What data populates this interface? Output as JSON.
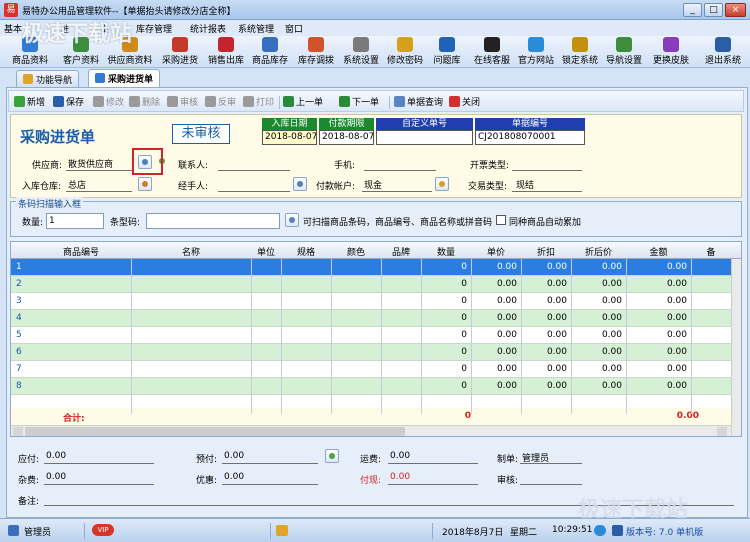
{
  "window": {
    "title": "易特办公用品管理软件--【单据抬头请修改分店全称】",
    "app_icon_glyph": "易"
  },
  "watermarks": {
    "top_left": "极速下载站",
    "bottom_right": "极速下载站"
  },
  "menu": [
    "基本",
    "进",
    "出",
    "库存管理",
    "统计报表",
    "系统管理",
    "窗口"
  ],
  "toolbar": [
    {
      "label": "商品资料",
      "icon": "box-icon",
      "color": "#2f7bd6"
    },
    {
      "label": "客户资料",
      "icon": "users-icon",
      "color": "#3c8e3c"
    },
    {
      "label": "供应商资料",
      "icon": "supplier-icon",
      "color": "#d08a1a"
    },
    {
      "label": "采购进货",
      "icon": "cart-icon",
      "color": "#c23b2a"
    },
    {
      "label": "销售出库",
      "icon": "sale-icon",
      "color": "#c2262c"
    },
    {
      "label": "商品库存",
      "icon": "stock-icon",
      "color": "#3a6fc0"
    },
    {
      "label": "库存调拨",
      "icon": "transfer-icon",
      "color": "#d1532a"
    },
    {
      "label": "系统设置",
      "icon": "settings-icon",
      "color": "#7a7a7a"
    },
    {
      "label": "修改密码",
      "icon": "key-icon",
      "color": "#d6a11a"
    },
    {
      "label": "问题库",
      "icon": "question-icon",
      "color": "#1f62b8"
    },
    {
      "label": "在线客服",
      "icon": "chat-icon",
      "color": "#222222"
    },
    {
      "label": "官方网站",
      "icon": "web-icon",
      "color": "#2a8bd6"
    },
    {
      "label": "锁定系统",
      "icon": "lock-icon",
      "color": "#c49012"
    },
    {
      "label": "导航设置",
      "icon": "nav-icon",
      "color": "#3c8e3c"
    },
    {
      "label": "更换皮肤",
      "icon": "skin-icon",
      "color": "#8a3cc0"
    },
    {
      "label": "退出系统",
      "icon": "exit-icon",
      "color": "#2a5fa8"
    }
  ],
  "tabs": [
    {
      "label": "功能导航",
      "icon": "nav-icon"
    },
    {
      "label": "采购进货单",
      "icon": "cart-icon"
    }
  ],
  "actions": [
    {
      "label": "新增",
      "icon": "plus-icon",
      "enabled": true
    },
    {
      "label": "保存",
      "icon": "save-icon",
      "enabled": true
    },
    {
      "label": "修改",
      "icon": "edit-icon",
      "enabled": false
    },
    {
      "label": "删除",
      "icon": "delete-icon",
      "enabled": false
    },
    {
      "label": "审核",
      "icon": "approve-icon",
      "enabled": false
    },
    {
      "label": "反审",
      "icon": "unapprove-icon",
      "enabled": false
    },
    {
      "label": "打印",
      "icon": "print-icon",
      "enabled": false
    },
    {
      "label": "上一单",
      "icon": "prev-icon",
      "enabled": true
    },
    {
      "label": "下一单",
      "icon": "next-icon",
      "enabled": true
    },
    {
      "label": "单据查询",
      "icon": "query-icon",
      "enabled": true
    },
    {
      "label": "关闭",
      "icon": "close-icon",
      "enabled": true
    }
  ],
  "doc": {
    "title": "采购进货单",
    "status": "未审核",
    "fields_header": [
      "入库日期",
      "付款期限",
      "自定义单号",
      "单据编号"
    ],
    "fields_values": [
      "2018-08-07",
      "2018-08-07",
      "",
      "CJ201808070001"
    ]
  },
  "form": {
    "supplier_label": "供应商:",
    "supplier_value": "散货供应商",
    "contact_label": "联系人:",
    "contact_value": "",
    "phone_label": "手机:",
    "phone_value": "",
    "invoice_label": "开票类型:",
    "invoice_value": "",
    "warehouse_label": "入库仓库:",
    "warehouse_value": "总店",
    "handler_label": "经手人:",
    "handler_value": "",
    "account_label": "付款帐户:",
    "account_value": "现金",
    "trade_label": "交易类型:",
    "trade_value": "现结"
  },
  "scan": {
    "legend": "条码扫描输入框",
    "qty_label": "数量:",
    "qty_value": "1",
    "barcode_label": "条型码:",
    "barcode_value": "",
    "hint": "可扫描商品条码，商品编号、商品名称或拼音码",
    "merge_label": "同种商品自动累加"
  },
  "grid": {
    "columns": [
      "商品编号",
      "名称",
      "单位",
      "规格",
      "颜色",
      "品牌",
      "数量",
      "单价",
      "折扣",
      "折后价",
      "金额",
      "备"
    ],
    "rows": [
      {
        "no": "1",
        "qty": "0",
        "price": "0.00",
        "discount": "0.00",
        "disc_price": "0.00",
        "amount": "0.00"
      },
      {
        "no": "2",
        "qty": "0",
        "price": "0.00",
        "discount": "0.00",
        "disc_price": "0.00",
        "amount": "0.00"
      },
      {
        "no": "3",
        "qty": "0",
        "price": "0.00",
        "discount": "0.00",
        "disc_price": "0.00",
        "amount": "0.00"
      },
      {
        "no": "4",
        "qty": "0",
        "price": "0.00",
        "discount": "0.00",
        "disc_price": "0.00",
        "amount": "0.00"
      },
      {
        "no": "5",
        "qty": "0",
        "price": "0.00",
        "discount": "0.00",
        "disc_price": "0.00",
        "amount": "0.00"
      },
      {
        "no": "6",
        "qty": "0",
        "price": "0.00",
        "discount": "0.00",
        "disc_price": "0.00",
        "amount": "0.00"
      },
      {
        "no": "7",
        "qty": "0",
        "price": "0.00",
        "discount": "0.00",
        "disc_price": "0.00",
        "amount": "0.00"
      },
      {
        "no": "8",
        "qty": "0",
        "price": "0.00",
        "discount": "0.00",
        "disc_price": "0.00",
        "amount": "0.00"
      }
    ],
    "total_label": "合计:",
    "total_qty": "0",
    "total_amount": "0.00",
    "selected_color": "#2a7de1",
    "stripe_color": "#d5f0d5"
  },
  "footer": {
    "payable_label": "应付:",
    "payable_value": "0.00",
    "prepaid_label": "预付:",
    "prepaid_value": "0.00",
    "freight_label": "运费:",
    "freight_value": "0.00",
    "maker_label": "制单:",
    "maker_value": "管理员",
    "misc_label": "杂费:",
    "misc_value": "0.00",
    "discount_label": "优惠:",
    "discount_value": "0.00",
    "paid_label": "付现:",
    "paid_value": "0.00",
    "reviewer_label": "审核:",
    "reviewer_value": "",
    "remark_label": "备注:",
    "remark_value": ""
  },
  "statusbar": {
    "user": "管理员",
    "badge": "VIP",
    "date": "2018年8月7日",
    "weekday": "星期二",
    "time": "10:29:51",
    "version": "版本号: 7.0 单机版"
  },
  "window_buttons": [
    "_",
    "□",
    "×"
  ]
}
